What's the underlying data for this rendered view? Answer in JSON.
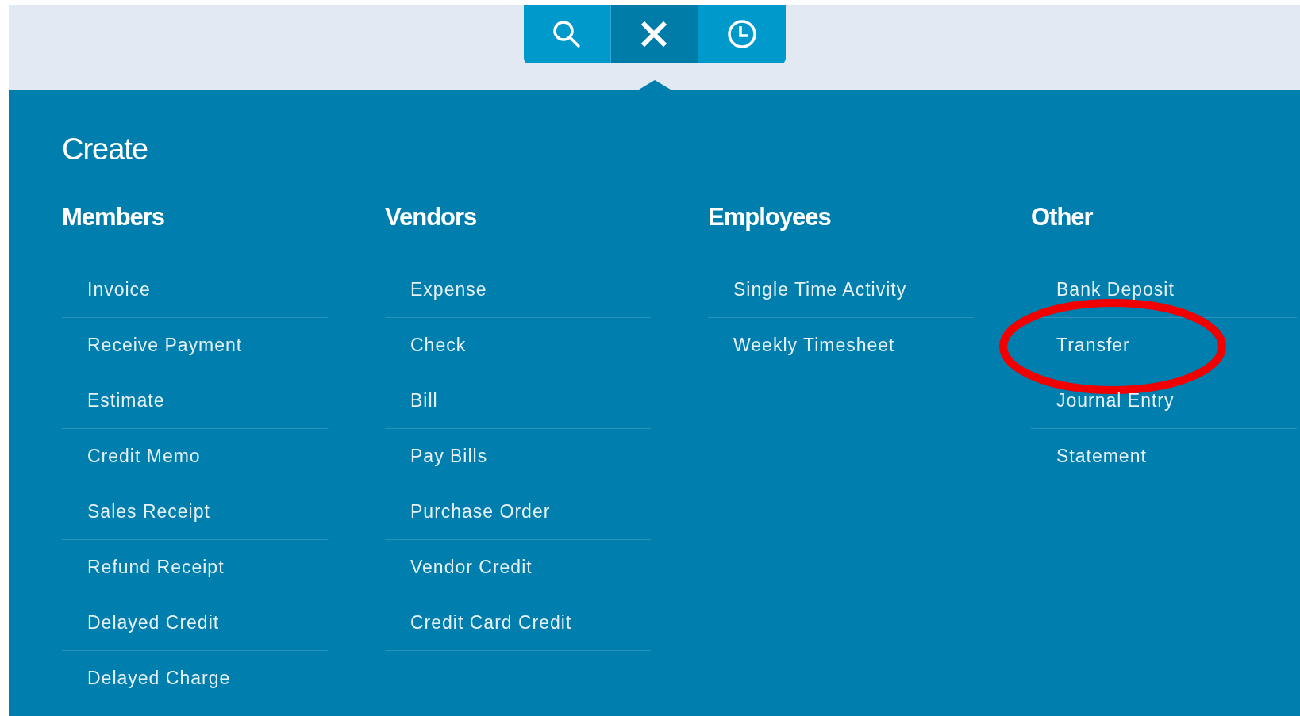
{
  "toolbar": [
    {
      "kind": "search",
      "selected": false
    },
    {
      "kind": "close",
      "selected": true
    },
    {
      "kind": "recent",
      "selected": false
    }
  ],
  "title": "Create",
  "columns": [
    {
      "heading": "Members",
      "items": [
        {
          "label": "Invoice",
          "circled": false
        },
        {
          "label": "Receive Payment",
          "circled": false
        },
        {
          "label": "Estimate",
          "circled": false
        },
        {
          "label": "Credit Memo",
          "circled": false
        },
        {
          "label": "Sales Receipt",
          "circled": false
        },
        {
          "label": "Refund Receipt",
          "circled": false
        },
        {
          "label": "Delayed Credit",
          "circled": false
        },
        {
          "label": "Delayed Charge",
          "circled": false
        }
      ]
    },
    {
      "heading": "Vendors",
      "items": [
        {
          "label": "Expense",
          "circled": false
        },
        {
          "label": "Check",
          "circled": false
        },
        {
          "label": "Bill",
          "circled": false
        },
        {
          "label": "Pay Bills",
          "circled": false
        },
        {
          "label": "Purchase Order",
          "circled": false
        },
        {
          "label": "Vendor Credit",
          "circled": false
        },
        {
          "label": "Credit Card Credit",
          "circled": false
        }
      ]
    },
    {
      "heading": "Employees",
      "items": [
        {
          "label": "Single Time Activity",
          "circled": false
        },
        {
          "label": "Weekly Timesheet",
          "circled": false
        }
      ]
    },
    {
      "heading": "Other",
      "items": [
        {
          "label": "Bank Deposit",
          "circled": false
        },
        {
          "label": "Transfer",
          "circled": true
        },
        {
          "label": "Journal Entry",
          "circled": false
        },
        {
          "label": "Statement",
          "circled": false
        }
      ]
    }
  ]
}
